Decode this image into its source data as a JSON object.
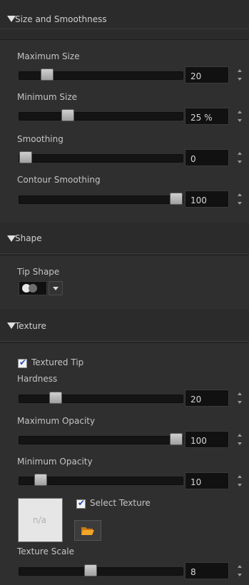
{
  "sections": {
    "size": {
      "title": "Size and Smoothness"
    },
    "shape": {
      "title": "Shape"
    },
    "texture": {
      "title": "Texture"
    }
  },
  "size": {
    "max_size": {
      "label": "Maximum Size",
      "value": "20",
      "slider_fraction": 0.14
    },
    "min_size": {
      "label": "Minimum Size",
      "value": "25 %",
      "slider_fraction": 0.28
    },
    "smoothing": {
      "label": "Smoothing",
      "value": "0",
      "slider_fraction": 0.0
    },
    "contour_smoothing": {
      "label": "Contour Smoothing",
      "value": "100",
      "slider_fraction": 1.0
    }
  },
  "shape": {
    "tip_shape_label": "Tip Shape",
    "tip_shape_icon": "filled-circle-icon"
  },
  "texture": {
    "textured_tip_label": "Textured Tip",
    "textured_tip_checked": true,
    "hardness": {
      "label": "Hardness",
      "value": "20",
      "slider_fraction": 0.2
    },
    "max_opacity": {
      "label": "Maximum Opacity",
      "value": "100",
      "slider_fraction": 1.0
    },
    "min_opacity": {
      "label": "Minimum Opacity",
      "value": "10",
      "slider_fraction": 0.1
    },
    "preview_text": "n/a",
    "select_texture_label": "Select Texture",
    "select_texture_checked": true,
    "texture_scale": {
      "label": "Texture Scale",
      "value": "8",
      "slider_fraction": 0.43
    }
  },
  "colors": {
    "panel_bg": "#2b2b2b",
    "track": "#141414",
    "thumb": "#bdbdbd",
    "field_bg": "#111111",
    "folder": "#f0a020"
  }
}
